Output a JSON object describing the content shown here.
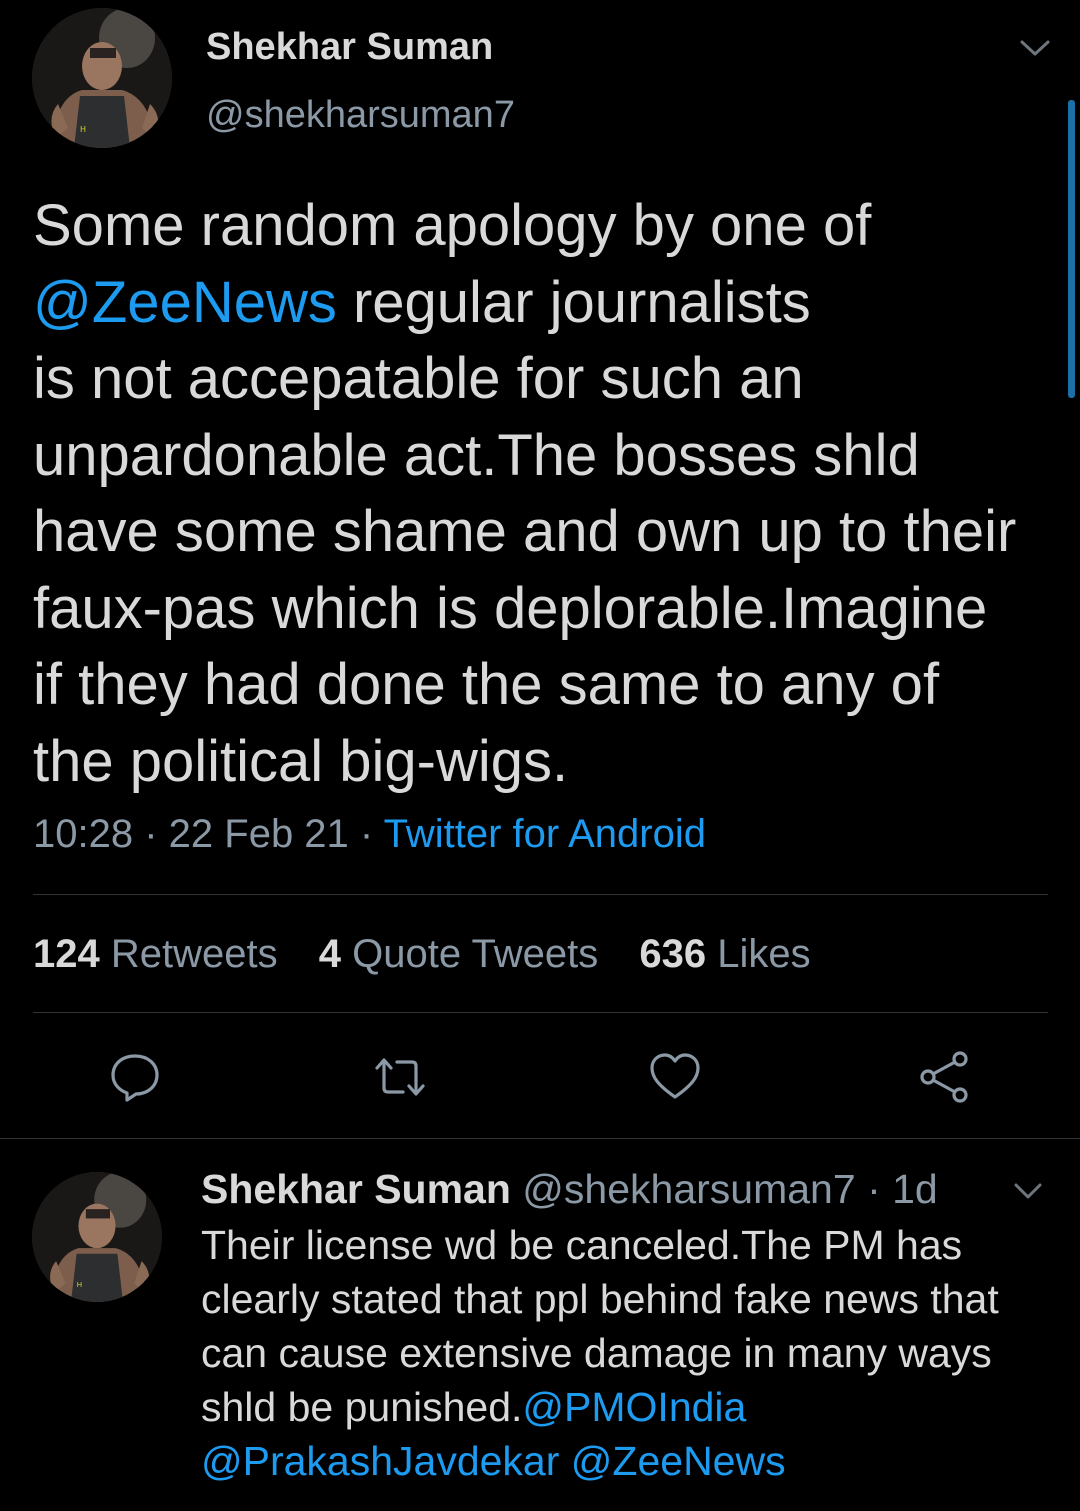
{
  "main_tweet": {
    "author_name": "Shekhar Suman",
    "author_handle": "@shekharsuman7",
    "text_lines": [
      {
        "segments": [
          {
            "text": "Some random apology by one of",
            "type": "text"
          }
        ]
      },
      {
        "segments": [
          {
            "text": "@ZeeNews",
            "type": "mention"
          },
          {
            "text": " regular journalists",
            "type": "text"
          }
        ]
      },
      {
        "segments": [
          {
            "text": "is not accepatable for such an",
            "type": "text"
          }
        ]
      },
      {
        "segments": [
          {
            "text": "unpardonable act.The bosses shld",
            "type": "text"
          }
        ]
      },
      {
        "segments": [
          {
            "text": "have some shame and own up to their",
            "type": "text"
          }
        ]
      },
      {
        "segments": [
          {
            "text": "faux-pas which is deplorable.Imagine",
            "type": "text"
          }
        ]
      },
      {
        "segments": [
          {
            "text": "if they had done the same to any of",
            "type": "text"
          }
        ]
      },
      {
        "segments": [
          {
            "text": "the political big-wigs.",
            "type": "text"
          }
        ]
      }
    ],
    "time": "10:28",
    "date": "22 Feb 21",
    "separator": " · ",
    "source": "Twitter for Android",
    "stats": {
      "retweets_count": "124",
      "retweets_label": "Retweets",
      "quotes_count": "4",
      "quotes_label": "Quote Tweets",
      "likes_count": "636",
      "likes_label": "Likes"
    }
  },
  "reply_tweet": {
    "author_name": "Shekhar Suman",
    "author_handle": "@shekharsuman7",
    "age": "· 1d",
    "text_lines": [
      {
        "segments": [
          {
            "text": "Their license wd be canceled.The PM has",
            "type": "text"
          }
        ]
      },
      {
        "segments": [
          {
            "text": "clearly stated that ppl behind fake news that",
            "type": "text"
          }
        ]
      },
      {
        "segments": [
          {
            "text": "can cause extensive damage in many ways",
            "type": "text"
          }
        ]
      },
      {
        "segments": [
          {
            "text": "shld be punished.",
            "type": "text"
          },
          {
            "text": "@PMOIndia",
            "type": "mention"
          }
        ]
      },
      {
        "segments": [
          {
            "text": "@PrakashJavdekar",
            "type": "mention"
          },
          {
            "text": " ",
            "type": "text"
          },
          {
            "text": "@ZeeNews",
            "type": "mention"
          }
        ]
      }
    ]
  },
  "icons": {
    "more": "chevron-down-icon",
    "reply": "reply-icon",
    "retweet": "retweet-icon",
    "like": "heart-icon",
    "share": "share-icon"
  },
  "colors": {
    "background": "#000000",
    "text": "#d9d9d9",
    "secondary": "#8b98a5",
    "accent": "#1d9bf0",
    "divider": "#2f3336"
  }
}
